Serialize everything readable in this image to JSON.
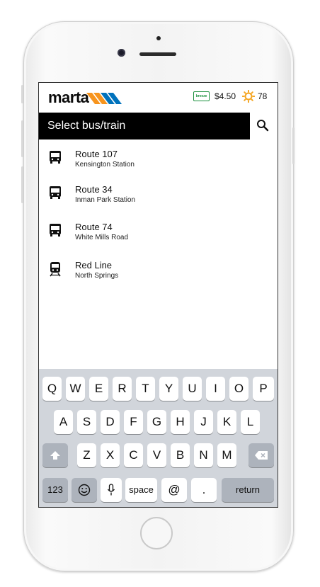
{
  "header": {
    "logo_text": "marta",
    "breeze_label": "breeze",
    "fare": "$4.50",
    "temperature": "78"
  },
  "search": {
    "placeholder": "Select bus/train"
  },
  "routes": [
    {
      "name": "Route 107",
      "stop": "Kensington Station",
      "icon": "bus-icon"
    },
    {
      "name": "Route 34",
      "stop": "Inman Park Station",
      "icon": "bus-icon"
    },
    {
      "name": "Route 74",
      "stop": "White Mills Road",
      "icon": "bus-icon"
    },
    {
      "name": "Red Line",
      "stop": "North Springs",
      "icon": "train-icon"
    }
  ],
  "keyboard": {
    "row1": [
      "Q",
      "W",
      "E",
      "R",
      "T",
      "Y",
      "U",
      "I",
      "O",
      "P"
    ],
    "row2": [
      "A",
      "S",
      "D",
      "F",
      "G",
      "H",
      "J",
      "K",
      "L"
    ],
    "row3": [
      "Z",
      "X",
      "C",
      "V",
      "B",
      "N",
      "M"
    ],
    "numbers": "123",
    "space": "space",
    "at": "@",
    "dot": ".",
    "return": "return"
  },
  "colors": {
    "accent_orange": "#f7941d",
    "accent_blue": "#0072bc",
    "breeze_green": "#1a8f3c",
    "sun": "#f5a623"
  }
}
